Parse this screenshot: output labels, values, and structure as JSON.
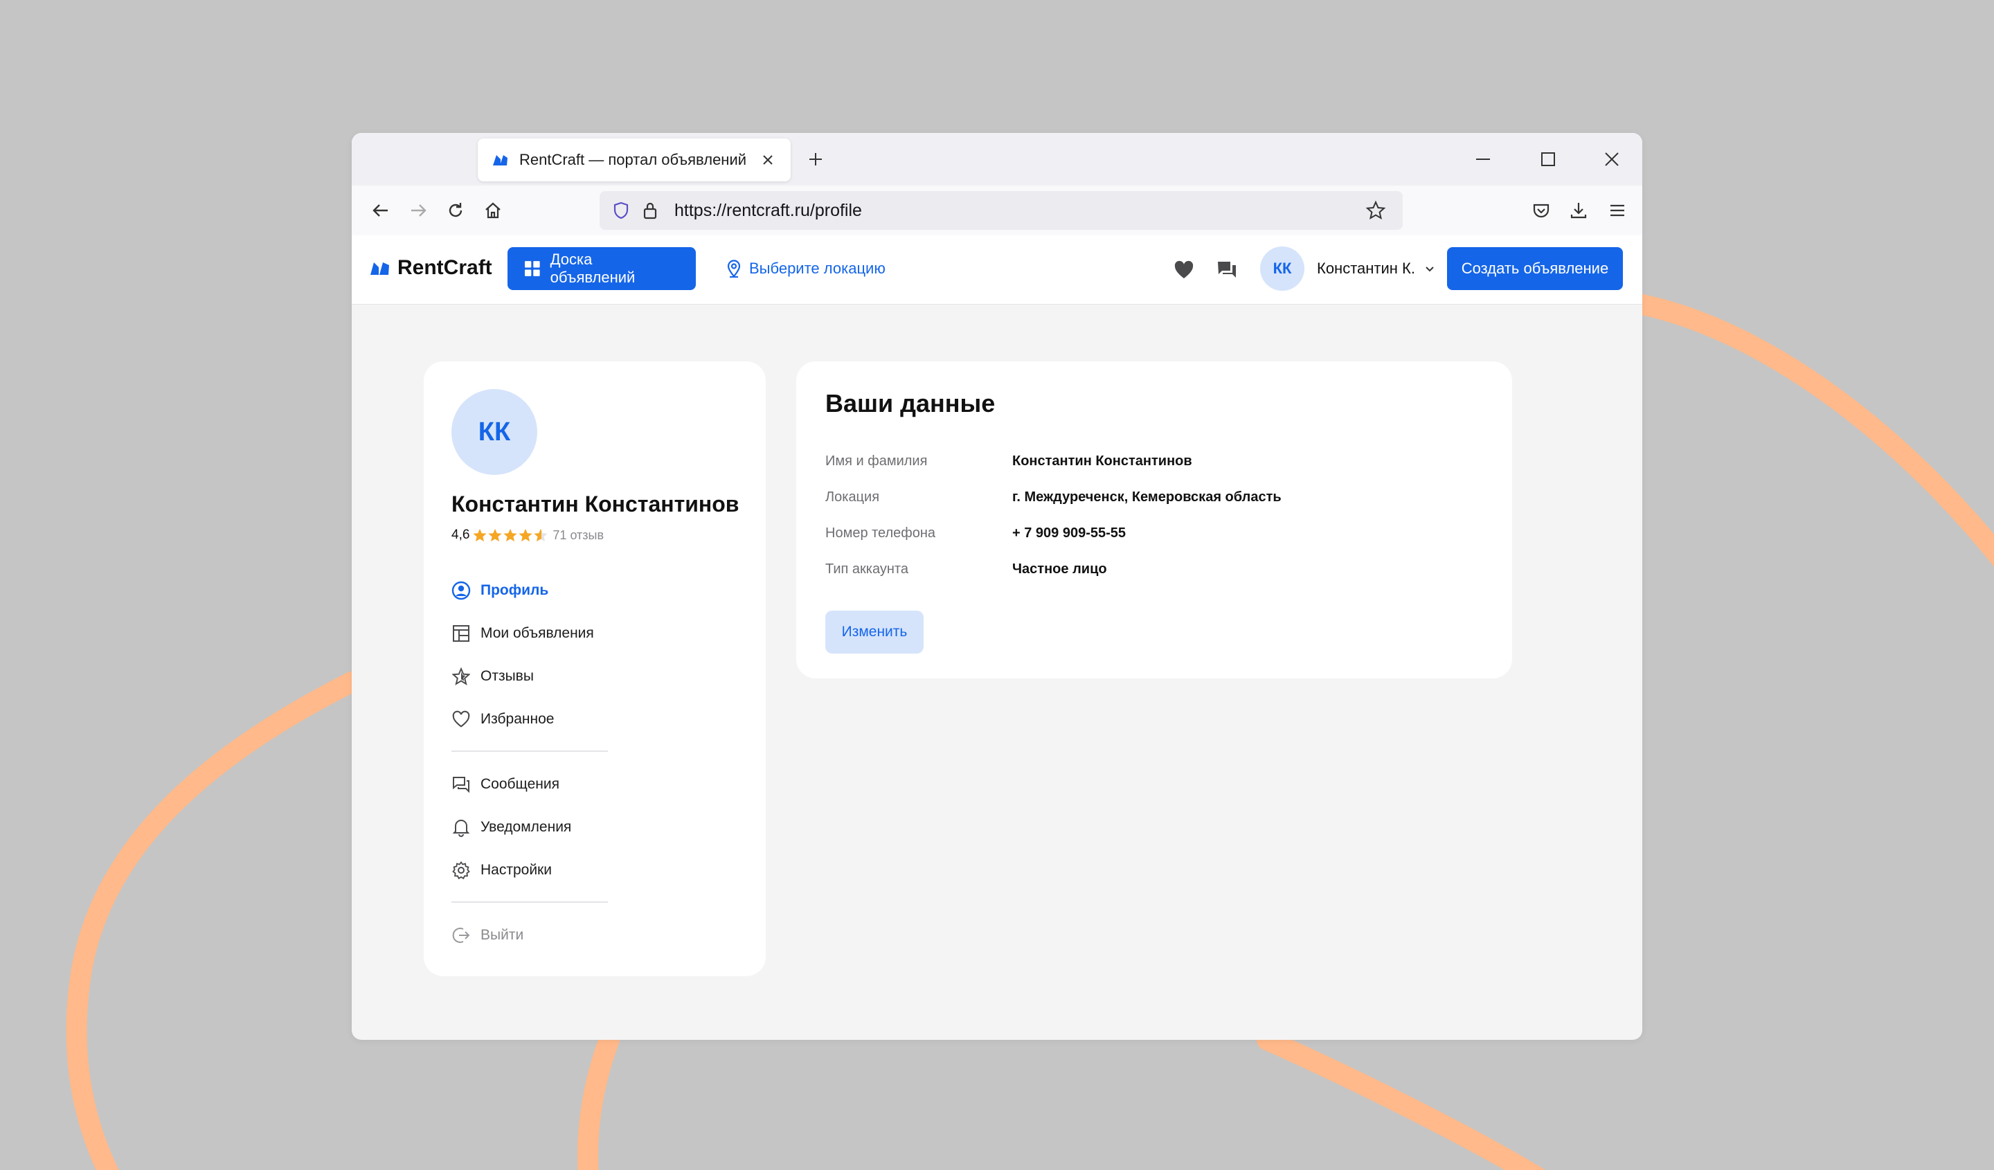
{
  "browser": {
    "tab_title": "RentCraft — портал объявлений",
    "url": "https://rentcraft.ru/profile"
  },
  "header": {
    "logo": "RentCraft",
    "board_button": "Доска объявлений",
    "location_link": "Выберите локацию",
    "user_initials": "КК",
    "user_name": "Константин К.",
    "create_button": "Создать объявление"
  },
  "profile": {
    "initials": "КК",
    "full_name": "Константин Константинов",
    "rating": "4,6",
    "rating_stars": 4.6,
    "reviews": "71 отзыв"
  },
  "menu": {
    "profile": "Профиль",
    "my_ads": "Мои объявления",
    "reviews": "Отзывы",
    "favorites": "Избранное",
    "messages": "Сообщения",
    "notifications": "Уведомления",
    "settings": "Настройки",
    "logout": "Выйти"
  },
  "details": {
    "title": "Ваши данные",
    "rows": [
      {
        "label": "Имя и фамилия",
        "value": "Константин Константинов"
      },
      {
        "label": "Локация",
        "value": "г. Междуреченск, Кемеровская область"
      },
      {
        "label": "Номер телефона",
        "value": "+ 7 909 909-55-55"
      },
      {
        "label": "Тип аккаунта",
        "value": "Частное лицо"
      }
    ],
    "edit_button": "Изменить"
  },
  "colors": {
    "accent": "#1565e8",
    "accent_light": "#d5e4fb",
    "star": "#f5a623",
    "decor_stroke": "#ffb98a",
    "background": "#c5c5c5"
  }
}
